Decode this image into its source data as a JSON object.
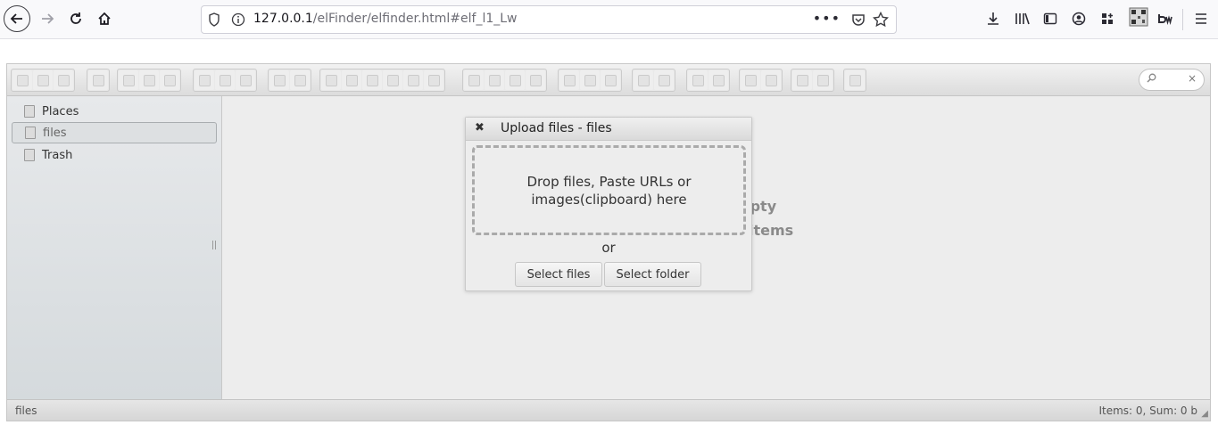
{
  "browser": {
    "url_host": "127.0.0.1",
    "url_path": "/elFinder/elfinder.html#elf_l1_Lw",
    "url_more": "•••"
  },
  "navbar": {
    "items": [
      {
        "label": "Places",
        "icon": "places-icon"
      },
      {
        "label": "files",
        "icon": "folder-icon",
        "active": true
      },
      {
        "label": "Trash",
        "icon": "trash-icon"
      }
    ]
  },
  "cwd": {
    "empty_line1": "Empty",
    "empty_line2": "No items"
  },
  "upload_dialog": {
    "title": "Upload files - files",
    "close_icon": "close-icon",
    "drop_text": "Drop files, Paste URLs or images(clipboard) here",
    "or_text": "or",
    "select_files_label": "Select files",
    "select_folder_label": "Select folder"
  },
  "statusbar": {
    "path": "files",
    "stats": "Items: 0, Sum: 0 b"
  },
  "search": {
    "clear_icon": "×"
  }
}
